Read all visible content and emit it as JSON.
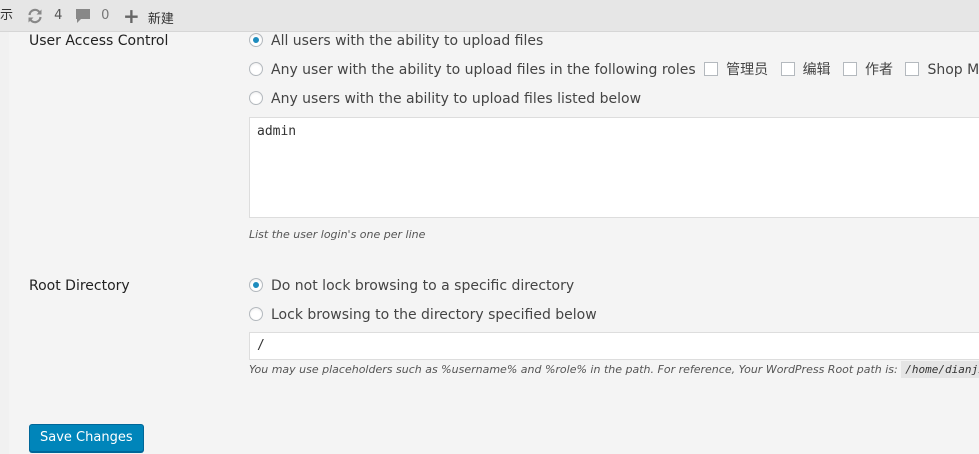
{
  "adminbar": {
    "partial_label": "示",
    "updates_count": "4",
    "comments_count": "0",
    "new_label": "新建"
  },
  "user_access": {
    "label": "User Access Control",
    "options": [
      "All users with the ability to upload files",
      "Any user with the ability to upload files in the following roles",
      "Any users with the ability to upload files listed below"
    ],
    "selected_index": 0,
    "roles": [
      "管理员",
      "编辑",
      "作者",
      "Shop Manage"
    ],
    "users_textarea_value": "admin",
    "users_help": "List the user login's one per line"
  },
  "root_directory": {
    "label": "Root Directory",
    "options": [
      "Do not lock browsing to a specific directory",
      "Lock browsing to the directory specified below"
    ],
    "selected_index": 0,
    "path_value": "/",
    "help_text": "You may use placeholders such as %username% and %role% in the path.  For reference, Your WordPress Root path is:",
    "root_path": "/home/dianjinc"
  },
  "save_button": "Save Changes",
  "colors": {
    "accent": "#0085ba",
    "radio_dot": "#1e8cbe"
  }
}
